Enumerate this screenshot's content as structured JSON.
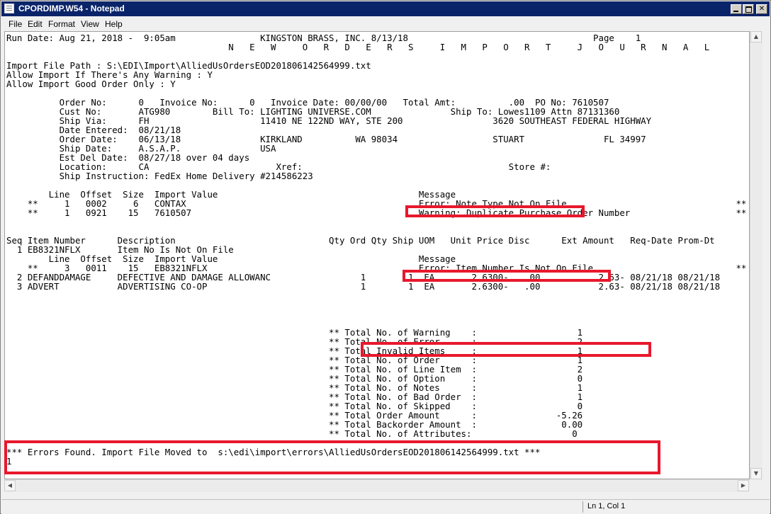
{
  "window": {
    "title": "CPORDIMP.W54 - Notepad"
  },
  "menu": [
    "File",
    "Edit",
    "Format",
    "View",
    "Help"
  ],
  "status": {
    "position": "Ln 1, Col 1"
  },
  "lines": [
    "Run Date: Aug 21, 2018 -  9:05am                KINGSTON BRASS, INC. 8/13/18                                   Page    1",
    "                                          N   E   W     O   R   D   E   R   S     I   M   P   O   R   T     J   O   U   R   N   A   L",
    "",
    "Import File Path : S:\\EDI\\Import\\AlliedUsOrdersEOD201806142564999.txt",
    "Allow Import If There's Any Warning : Y",
    "Allow Import Good Order Only : Y",
    "",
    "          Order No:      0   Invoice No:      0   Invoice Date: 00/00/00   Total Amt:          .00  PO No: 7610507",
    "          Cust No:       ATG980        Bill To: LIGHTING UNIVERSE.COM               Ship To: Lowes1109 Attn 87131360",
    "          Ship Via:      FH                     11410 NE 122ND WAY, STE 200                 3620 SOUTHEAST FEDERAL HIGHWAY",
    "          Date Entered:  08/21/18",
    "          Order Date:    06/13/18               KIRKLAND          WA 98034                  STUART               FL 34997",
    "          Ship Date:     A.S.A.P.               USA",
    "          Est Del Date:  08/27/18 over 04 days",
    "          Location:      CA                        Xref:                                       Store #:",
    "          Ship Instruction: FedEx Home Delivery #214586223",
    "",
    "        Line  Offset  Size  Import Value                                      Message",
    "    **     1   0002     6   CONTAX                                            Error: Note Type Not On File                                **",
    "    **     1   0921    15   7610507                                           Warning: Duplicate Purchase Order Number                    **",
    "",
    "",
    "Seq Item Number      Description                             Qty Ord Qty Ship UOM   Unit Price Disc      Ext Amount   Req-Date Prom-Dt",
    "  1 EB8321NFLX       Item No Is Not On File",
    "        Line  Offset  Size  Import Value                                      Message",
    "    **     3   0011    15   EB8321NFLX                                        Error: Item Number Is Not On File                           **",
    "  2 DEFANDDAMAGE     DEFECTIVE AND DAMAGE ALLOWANC                 1        1  EA       2.6300-   .00           2.63- 08/21/18 08/21/18",
    "  3 ADVERT           ADVERTISING CO-OP                             1        1  EA       2.6300-   .00           2.63- 08/21/18 08/21/18",
    "",
    "",
    "",
    "",
    "                                                             ** Total No. of Warning    :                   1",
    "                                                             ** Total No. of Error      :                   2",
    "                                                             ** Total Invalid Items     :                   1",
    "                                                             ** Total No. of Order      :                   1",
    "                                                             ** Total No. of Line Item  :                   2",
    "                                                             ** Total No. of Option     :                   0",
    "                                                             ** Total No. of Notes      :                   1",
    "                                                             ** Total No. of Bad Order  :                   1",
    "                                                             ** Total No. of Skipped    :                   0",
    "                                                             ** Total Order Amount      :               -5.26",
    "                                                             ** Total Backorder Amount  :                0.00",
    "                                                             ** Total No. of Attributes:                   0",
    "",
    "*** Errors Found. Import File Moved to  s:\\edi\\import\\errors\\AlliedUsOrdersEOD201806142564999.txt ***",
    "1"
  ]
}
